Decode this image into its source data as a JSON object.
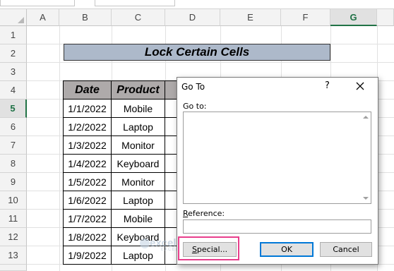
{
  "sheet": {
    "columns": [
      "A",
      "B",
      "C",
      "D",
      "E",
      "F",
      "G"
    ],
    "selected_column": "G",
    "rows": [
      "1",
      "2",
      "3",
      "4",
      "5",
      "6",
      "7",
      "8",
      "9",
      "10",
      "11",
      "12",
      "13"
    ],
    "selected_row": "5",
    "title": "Lock Certain Cells",
    "table": {
      "headers": [
        "Date",
        "Product"
      ],
      "rows": [
        [
          "1/1/2022",
          "Mobile"
        ],
        [
          "1/2/2022",
          "Laptop"
        ],
        [
          "1/3/2022",
          "Monitor"
        ],
        [
          "1/4/2022",
          "Keyboard"
        ],
        [
          "1/5/2022",
          "Monitor"
        ],
        [
          "1/6/2022",
          "Laptop"
        ],
        [
          "1/7/2022",
          "Mobile"
        ],
        [
          "1/8/2022",
          "Keyboard"
        ],
        [
          "1/9/2022",
          "Laptop"
        ]
      ]
    }
  },
  "dialog": {
    "title": "Go To",
    "help": "?",
    "goto_label": "Go to:",
    "reference_label_r": "R",
    "reference_label_rest": "eference:",
    "reference_value": "",
    "buttons": {
      "special_s": "S",
      "special_rest": "pecial...",
      "ok": "OK",
      "cancel": "Cancel"
    }
  },
  "watermark": {
    "name": "exceldemy",
    "tagline": "EXCEL · DATA · BI"
  },
  "colors": {
    "title_fill": "#adb9ca",
    "header_fill": "#aeaaaa",
    "highlight": "#e83e8c",
    "excel_green": "#217346",
    "default_button": "#0078d7"
  }
}
